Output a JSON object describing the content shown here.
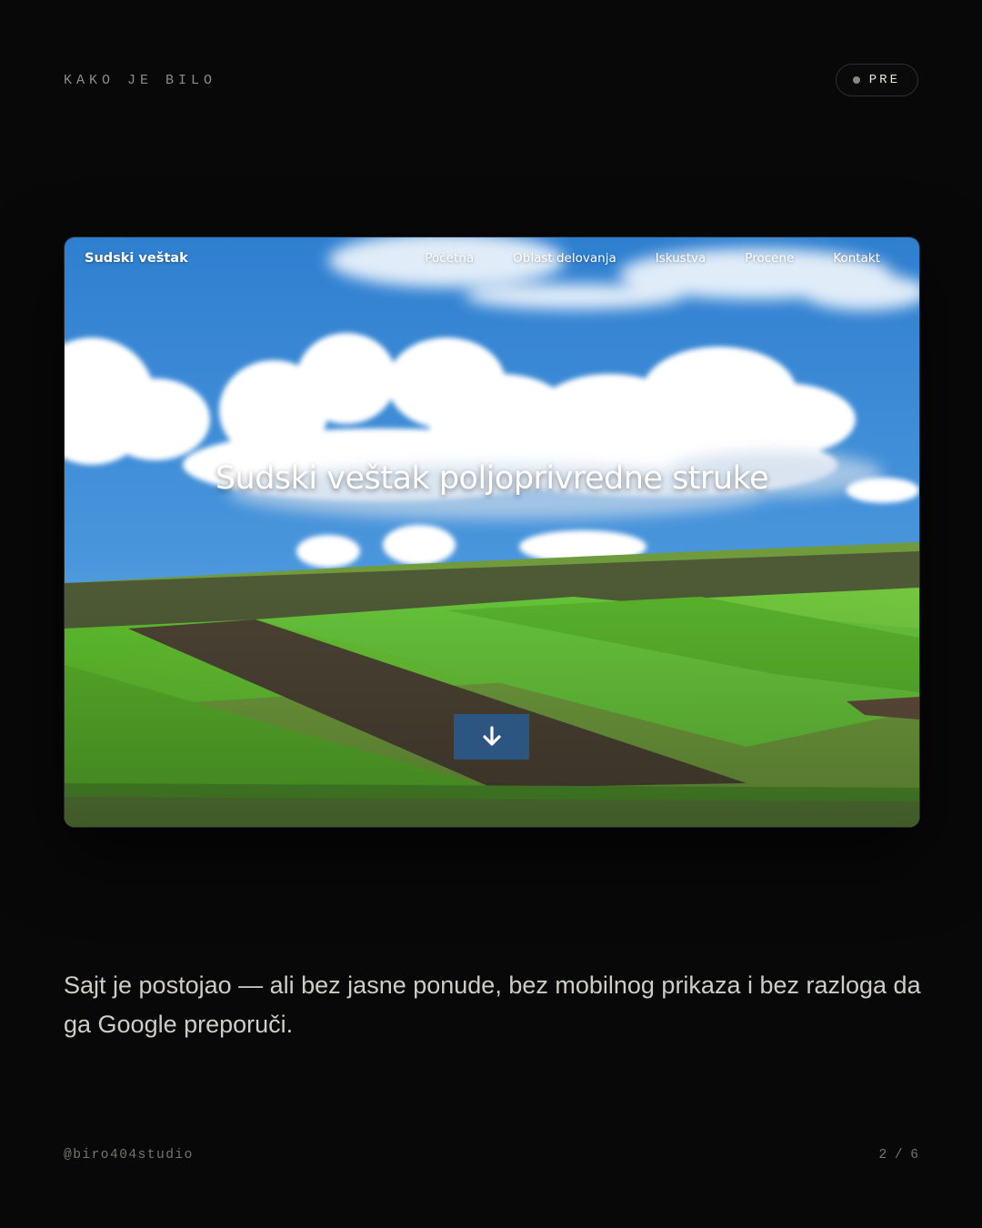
{
  "header": {
    "label": "KAKO JE BILO",
    "badge_label": "PRE"
  },
  "screenshot": {
    "brand": "Sudski veštak",
    "nav_items": [
      {
        "label": "Početna"
      },
      {
        "label": "Oblast delovanja"
      },
      {
        "label": "Iskustva"
      },
      {
        "label": "Procene"
      },
      {
        "label": "Kontakt"
      }
    ],
    "hero_title": "Sudski veštak poljoprivredne struke",
    "scroll_button_icon": "arrow-down-icon",
    "colors": {
      "sky": "#3a86cf",
      "field": "#4fb02c",
      "button": "#2d5582"
    }
  },
  "body": {
    "text": "Sajt je postojao — ali bez jasne ponude, bez mobilnog prikaza i bez razloga da ga Google preporuči."
  },
  "footer": {
    "handle": "@biro404studio",
    "page_counter": "2 / 6"
  }
}
